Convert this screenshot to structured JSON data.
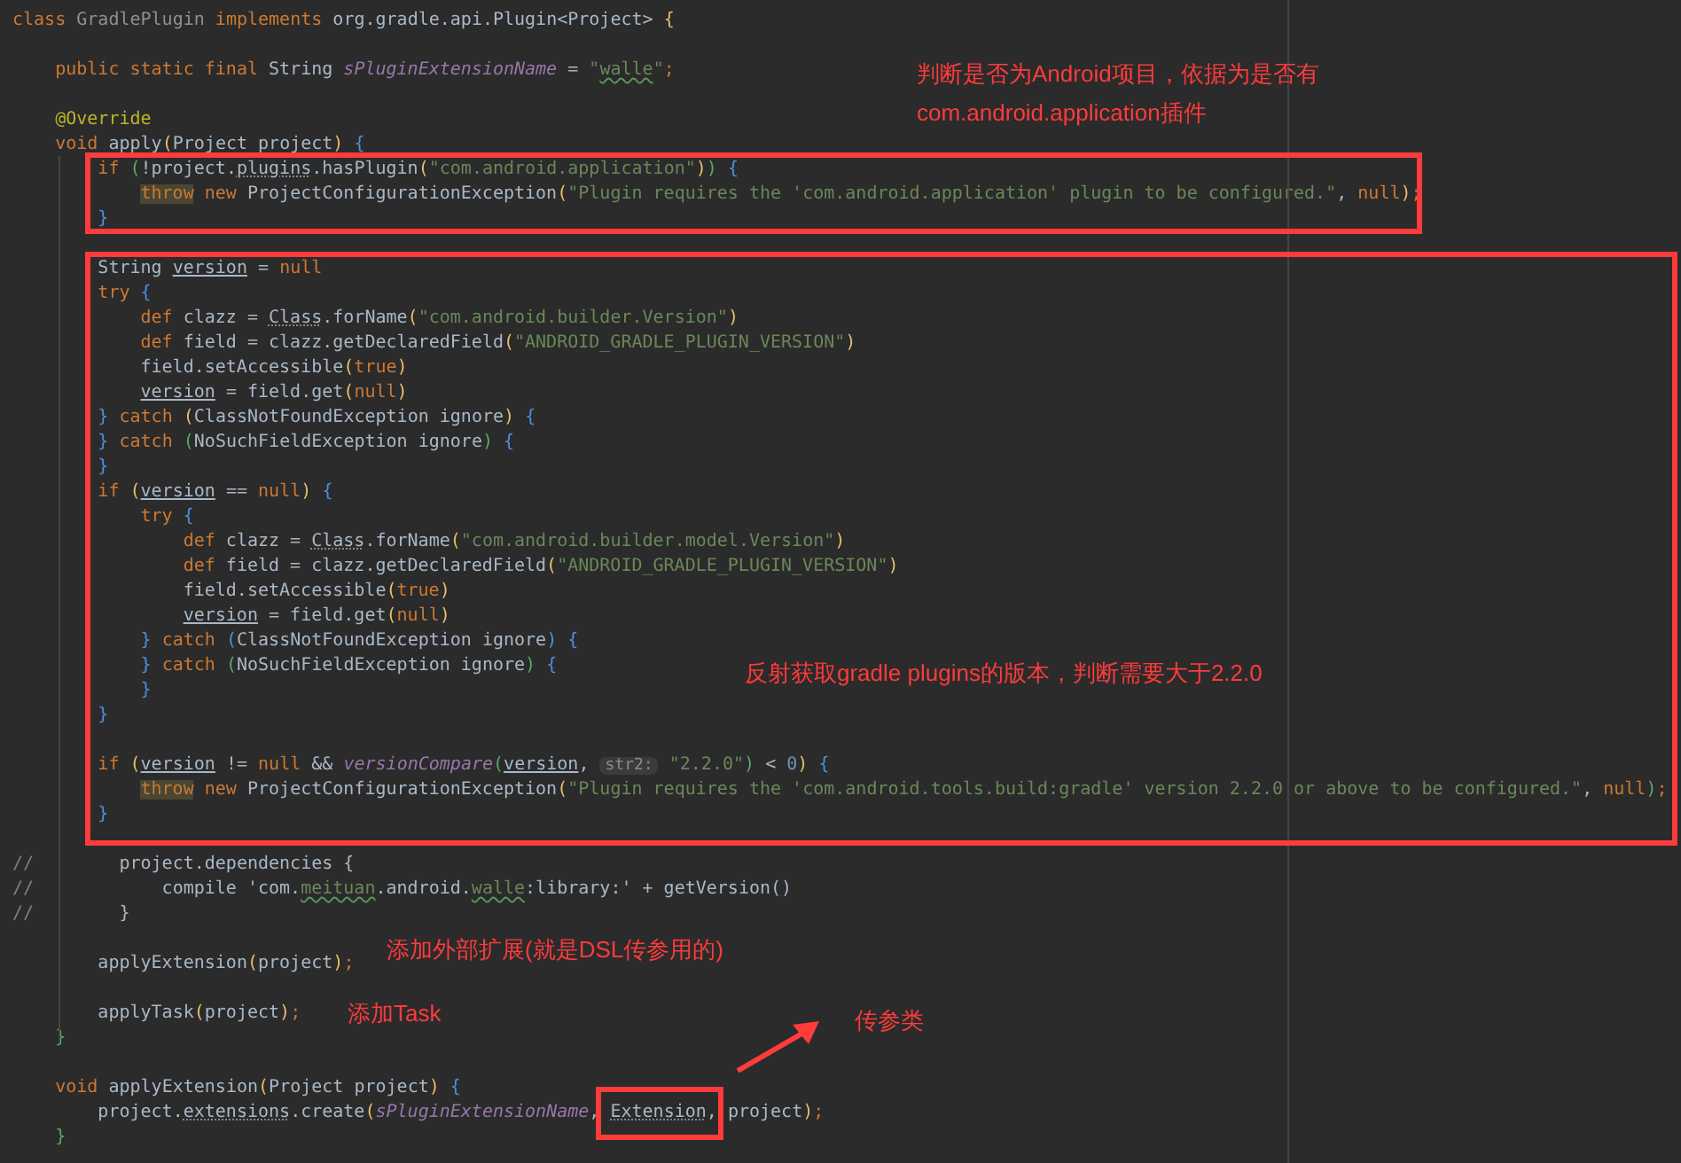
{
  "code_lines": [
    {
      "kind": "code",
      "tokens": [
        {
          "kind": "kw",
          "text": "class"
        },
        {
          "kind": "dim",
          "text": " GradlePlugin "
        },
        {
          "kind": "kw",
          "text": "implements"
        },
        {
          "kind": "plain",
          "text": " org.gradle.api.Plugin<Project> "
        },
        {
          "kind": "brace_y",
          "text": "{"
        }
      ]
    },
    {
      "kind": "blank"
    },
    {
      "kind": "code",
      "tokens": [
        {
          "kind": "kw",
          "text": "    public static final"
        },
        {
          "kind": "plain",
          "text": " String "
        },
        {
          "kind": "field",
          "text": "sPluginExtensionName"
        },
        {
          "kind": "plain",
          "text": " = "
        },
        {
          "kind": "str",
          "text": "\""
        },
        {
          "kind": "squig",
          "text": "walle"
        },
        {
          "kind": "str",
          "text": "\""
        },
        {
          "kind": "kw",
          "text": ";"
        }
      ]
    },
    {
      "kind": "blank"
    },
    {
      "kind": "code",
      "tokens": [
        {
          "kind": "ann",
          "text": "    @Override"
        }
      ]
    },
    {
      "kind": "code",
      "tokens": [
        {
          "kind": "kw",
          "text": "    void"
        },
        {
          "kind": "plain",
          "text": " apply"
        },
        {
          "kind": "brace_y",
          "text": "("
        },
        {
          "kind": "plain",
          "text": "Project project"
        },
        {
          "kind": "brace_y",
          "text": ")"
        },
        {
          "kind": "brace_b",
          "text": " {"
        }
      ]
    },
    {
      "kind": "code",
      "tokens": [
        {
          "kind": "kw",
          "text": "        if"
        },
        {
          "kind": "brace_g",
          "text": " ("
        },
        {
          "kind": "plain",
          "text": "!project."
        },
        {
          "kind": "dotted",
          "text": "plugins"
        },
        {
          "kind": "plain",
          "text": ".hasPlugin"
        },
        {
          "kind": "brace_y",
          "text": "("
        },
        {
          "kind": "str",
          "text": "\"com.android.application\""
        },
        {
          "kind": "brace_y",
          "text": ")"
        },
        {
          "kind": "brace_g",
          "text": ")"
        },
        {
          "kind": "brace_b",
          "text": " {"
        }
      ]
    },
    {
      "kind": "code",
      "tokens": [
        {
          "kind": "throw",
          "text": "            throw"
        },
        {
          "kind": "kw",
          "text": " new"
        },
        {
          "kind": "plain",
          "text": " ProjectConfigurationException"
        },
        {
          "kind": "brace_y",
          "text": "("
        },
        {
          "kind": "str",
          "text": "\"Plugin requires the 'com.android.application' plugin to be configured.\""
        },
        {
          "kind": "plain",
          "text": ", "
        },
        {
          "kind": "kw",
          "text": "null"
        },
        {
          "kind": "brace_y",
          "text": ")"
        },
        {
          "kind": "kw",
          "text": ";"
        }
      ]
    },
    {
      "kind": "code",
      "tokens": [
        {
          "kind": "brace_b",
          "text": "        }"
        }
      ]
    },
    {
      "kind": "blank"
    },
    {
      "kind": "code",
      "tokens": [
        {
          "kind": "plain",
          "text": "        String "
        },
        {
          "kind": "uline",
          "text": "version"
        },
        {
          "kind": "plain",
          "text": " = "
        },
        {
          "kind": "kw",
          "text": "null"
        }
      ]
    },
    {
      "kind": "code",
      "tokens": [
        {
          "kind": "kw",
          "text": "        try"
        },
        {
          "kind": "brace_b",
          "text": " {"
        }
      ]
    },
    {
      "kind": "code",
      "tokens": [
        {
          "kind": "kw",
          "text": "            def"
        },
        {
          "kind": "plain",
          "text": " clazz = "
        },
        {
          "kind": "dotted",
          "text": "Class"
        },
        {
          "kind": "plain",
          "text": ".forName"
        },
        {
          "kind": "brace_y",
          "text": "("
        },
        {
          "kind": "str",
          "text": "\"com.android.builder.Version\""
        },
        {
          "kind": "brace_y",
          "text": ")"
        }
      ]
    },
    {
      "kind": "code",
      "tokens": [
        {
          "kind": "kw",
          "text": "            def"
        },
        {
          "kind": "plain",
          "text": " field = clazz.getDeclaredField"
        },
        {
          "kind": "brace_y",
          "text": "("
        },
        {
          "kind": "str",
          "text": "\"ANDROID_GRADLE_PLUGIN_VERSION\""
        },
        {
          "kind": "brace_y",
          "text": ")"
        }
      ]
    },
    {
      "kind": "code",
      "tokens": [
        {
          "kind": "plain",
          "text": "            field.setAccessible"
        },
        {
          "kind": "brace_y",
          "text": "("
        },
        {
          "kind": "kw",
          "text": "true"
        },
        {
          "kind": "brace_y",
          "text": ")"
        }
      ]
    },
    {
      "kind": "code",
      "tokens": [
        {
          "kind": "uline",
          "text": "            version"
        },
        {
          "kind": "plain",
          "text": " = field.get"
        },
        {
          "kind": "brace_y",
          "text": "("
        },
        {
          "kind": "kw",
          "text": "null"
        },
        {
          "kind": "brace_y",
          "text": ")"
        }
      ]
    },
    {
      "kind": "code",
      "tokens": [
        {
          "kind": "brace_b",
          "text": "        }"
        },
        {
          "kind": "kw",
          "text": " catch"
        },
        {
          "kind": "brace_y",
          "text": " ("
        },
        {
          "kind": "plain",
          "text": "ClassNotFoundException ignore"
        },
        {
          "kind": "brace_y",
          "text": ")"
        },
        {
          "kind": "brace_b",
          "text": " {"
        }
      ]
    },
    {
      "kind": "code",
      "tokens": [
        {
          "kind": "brace_b",
          "text": "        }"
        },
        {
          "kind": "kw",
          "text": " catch"
        },
        {
          "kind": "brace_g",
          "text": " ("
        },
        {
          "kind": "plain",
          "text": "NoSuchFieldException ignore"
        },
        {
          "kind": "brace_g",
          "text": ")"
        },
        {
          "kind": "brace_b",
          "text": " {"
        }
      ]
    },
    {
      "kind": "code",
      "tokens": [
        {
          "kind": "brace_b",
          "text": "        }"
        }
      ]
    },
    {
      "kind": "code",
      "tokens": [
        {
          "kind": "kw",
          "text": "        if"
        },
        {
          "kind": "brace_y",
          "text": " ("
        },
        {
          "kind": "uline",
          "text": "version"
        },
        {
          "kind": "plain",
          "text": " == "
        },
        {
          "kind": "kw",
          "text": "null"
        },
        {
          "kind": "brace_y",
          "text": ")"
        },
        {
          "kind": "brace_b",
          "text": " {"
        }
      ]
    },
    {
      "kind": "code",
      "tokens": [
        {
          "kind": "kw",
          "text": "            try"
        },
        {
          "kind": "brace_b",
          "text": " {"
        }
      ]
    },
    {
      "kind": "code",
      "tokens": [
        {
          "kind": "kw",
          "text": "                def"
        },
        {
          "kind": "plain",
          "text": " clazz = "
        },
        {
          "kind": "dotted",
          "text": "Class"
        },
        {
          "kind": "plain",
          "text": ".forName"
        },
        {
          "kind": "brace_y",
          "text": "("
        },
        {
          "kind": "str",
          "text": "\"com.android.builder.model.Version\""
        },
        {
          "kind": "brace_y",
          "text": ")"
        }
      ]
    },
    {
      "kind": "code",
      "tokens": [
        {
          "kind": "kw",
          "text": "                def"
        },
        {
          "kind": "plain",
          "text": " field = clazz.getDeclaredField"
        },
        {
          "kind": "brace_y",
          "text": "("
        },
        {
          "kind": "str",
          "text": "\"ANDROID_GRADLE_PLUGIN_VERSION\""
        },
        {
          "kind": "brace_y",
          "text": ")"
        }
      ]
    },
    {
      "kind": "code",
      "tokens": [
        {
          "kind": "plain",
          "text": "                field.setAccessible"
        },
        {
          "kind": "brace_y",
          "text": "("
        },
        {
          "kind": "kw",
          "text": "true"
        },
        {
          "kind": "brace_y",
          "text": ")"
        }
      ]
    },
    {
      "kind": "code",
      "tokens": [
        {
          "kind": "uline",
          "text": "                version"
        },
        {
          "kind": "plain",
          "text": " = field.get"
        },
        {
          "kind": "brace_y",
          "text": "("
        },
        {
          "kind": "kw",
          "text": "null"
        },
        {
          "kind": "brace_y",
          "text": ")"
        }
      ]
    },
    {
      "kind": "code",
      "tokens": [
        {
          "kind": "brace_b",
          "text": "            }"
        },
        {
          "kind": "kw",
          "text": " catch"
        },
        {
          "kind": "brace_b",
          "text": " ("
        },
        {
          "kind": "plain",
          "text": "ClassNotFoundException ignore"
        },
        {
          "kind": "brace_b",
          "text": ")"
        },
        {
          "kind": "brace_b",
          "text": " {"
        }
      ]
    },
    {
      "kind": "code",
      "tokens": [
        {
          "kind": "brace_b",
          "text": "            }"
        },
        {
          "kind": "kw",
          "text": " catch"
        },
        {
          "kind": "brace_g",
          "text": " ("
        },
        {
          "kind": "plain",
          "text": "NoSuchFieldException ignore"
        },
        {
          "kind": "brace_g",
          "text": ")"
        },
        {
          "kind": "brace_b",
          "text": " {"
        }
      ]
    },
    {
      "kind": "code",
      "tokens": [
        {
          "kind": "brace_b",
          "text": "            }"
        }
      ]
    },
    {
      "kind": "code",
      "tokens": [
        {
          "kind": "brace_b",
          "text": "        }"
        }
      ]
    },
    {
      "kind": "blank"
    },
    {
      "kind": "code",
      "tokens": [
        {
          "kind": "kw",
          "text": "        if"
        },
        {
          "kind": "brace_y",
          "text": " ("
        },
        {
          "kind": "uline",
          "text": "version"
        },
        {
          "kind": "plain",
          "text": " != "
        },
        {
          "kind": "kw",
          "text": "null"
        },
        {
          "kind": "plain",
          "text": " && "
        },
        {
          "kind": "call",
          "text": "versionCompare"
        },
        {
          "kind": "brace_g",
          "text": "("
        },
        {
          "kind": "uline",
          "text": "version"
        },
        {
          "kind": "plain",
          "text": ", "
        },
        {
          "kind": "hint",
          "text": "str2:"
        },
        {
          "kind": "str",
          "text": " \"2.2.0\""
        },
        {
          "kind": "brace_g",
          "text": ")"
        },
        {
          "kind": "plain",
          "text": " < "
        },
        {
          "kind": "num",
          "text": "0"
        },
        {
          "kind": "brace_y",
          "text": ")"
        },
        {
          "kind": "brace_b",
          "text": " {"
        }
      ]
    },
    {
      "kind": "code",
      "tokens": [
        {
          "kind": "throw",
          "text": "            throw"
        },
        {
          "kind": "kw",
          "text": " new"
        },
        {
          "kind": "plain",
          "text": " ProjectConfigurationException"
        },
        {
          "kind": "brace_y",
          "text": "("
        },
        {
          "kind": "str",
          "text": "\"Plugin requires the 'com.android.tools.build:gradle' version 2.2.0 or above to be configured.\""
        },
        {
          "kind": "plain",
          "text": ", "
        },
        {
          "kind": "kw",
          "text": "null"
        },
        {
          "kind": "brace_g",
          "text": ")"
        },
        {
          "kind": "kw",
          "text": ";"
        }
      ]
    },
    {
      "kind": "code",
      "tokens": [
        {
          "kind": "brace_b",
          "text": "        }"
        }
      ]
    },
    {
      "kind": "blank"
    },
    {
      "kind": "code",
      "tokens": [
        {
          "kind": "comment",
          "text": "//"
        },
        {
          "kind": "plain",
          "text": "        project.dependencies {"
        }
      ]
    },
    {
      "kind": "code",
      "tokens": [
        {
          "kind": "comment",
          "text": "//"
        },
        {
          "kind": "plain",
          "text": "            compile 'com."
        },
        {
          "kind": "squig",
          "text": "meituan"
        },
        {
          "kind": "plain",
          "text": ".android."
        },
        {
          "kind": "squig",
          "text": "walle"
        },
        {
          "kind": "plain",
          "text": ":library:' + getVersion()"
        }
      ]
    },
    {
      "kind": "code",
      "tokens": [
        {
          "kind": "comment",
          "text": "//"
        },
        {
          "kind": "plain",
          "text": "        }"
        }
      ]
    },
    {
      "kind": "blank"
    },
    {
      "kind": "code",
      "tokens": [
        {
          "kind": "plain",
          "text": "        applyExtension"
        },
        {
          "kind": "brace_y",
          "text": "("
        },
        {
          "kind": "plain",
          "text": "project"
        },
        {
          "kind": "brace_y",
          "text": ")"
        },
        {
          "kind": "kw",
          "text": ";"
        }
      ]
    },
    {
      "kind": "blank"
    },
    {
      "kind": "code",
      "tokens": [
        {
          "kind": "plain",
          "text": "        applyTask"
        },
        {
          "kind": "brace_y",
          "text": "("
        },
        {
          "kind": "plain",
          "text": "project"
        },
        {
          "kind": "brace_y",
          "text": ")"
        },
        {
          "kind": "kw",
          "text": ";"
        }
      ]
    },
    {
      "kind": "code",
      "tokens": [
        {
          "kind": "brace_g",
          "text": "    }"
        }
      ]
    },
    {
      "kind": "blank"
    },
    {
      "kind": "code",
      "tokens": [
        {
          "kind": "kw",
          "text": "    void"
        },
        {
          "kind": "plain",
          "text": " applyExtension"
        },
        {
          "kind": "brace_y",
          "text": "("
        },
        {
          "kind": "plain",
          "text": "Project project"
        },
        {
          "kind": "brace_y",
          "text": ")"
        },
        {
          "kind": "brace_b",
          "text": " {"
        }
      ]
    },
    {
      "kind": "code",
      "tokens": [
        {
          "kind": "plain",
          "text": "        project."
        },
        {
          "kind": "dotted",
          "text": "extensions"
        },
        {
          "kind": "plain",
          "text": ".create"
        },
        {
          "kind": "brace_y",
          "text": "("
        },
        {
          "kind": "field",
          "text": "sPluginExtensionName"
        },
        {
          "kind": "plain",
          "text": ", "
        },
        {
          "kind": "dotted",
          "text": "Extension"
        },
        {
          "kind": "plain",
          "text": ", project"
        },
        {
          "kind": "brace_y",
          "text": ")"
        },
        {
          "kind": "kw",
          "text": ";"
        }
      ]
    },
    {
      "kind": "code",
      "tokens": [
        {
          "kind": "brace_g",
          "text": "    }"
        }
      ]
    }
  ],
  "annotations": [
    {
      "lines": [
        "判断是否为Android项目，依据为是否有",
        "com.android.application插件"
      ]
    },
    {
      "lines": [
        "反射获取gradle plugins的版本，判断需要大于2.2.0"
      ]
    },
    {
      "lines": [
        "添加外部扩展(就是DSL传参用的)"
      ]
    },
    {
      "lines": [
        "添加Task"
      ]
    },
    {
      "lines": [
        "传参类"
      ]
    }
  ]
}
